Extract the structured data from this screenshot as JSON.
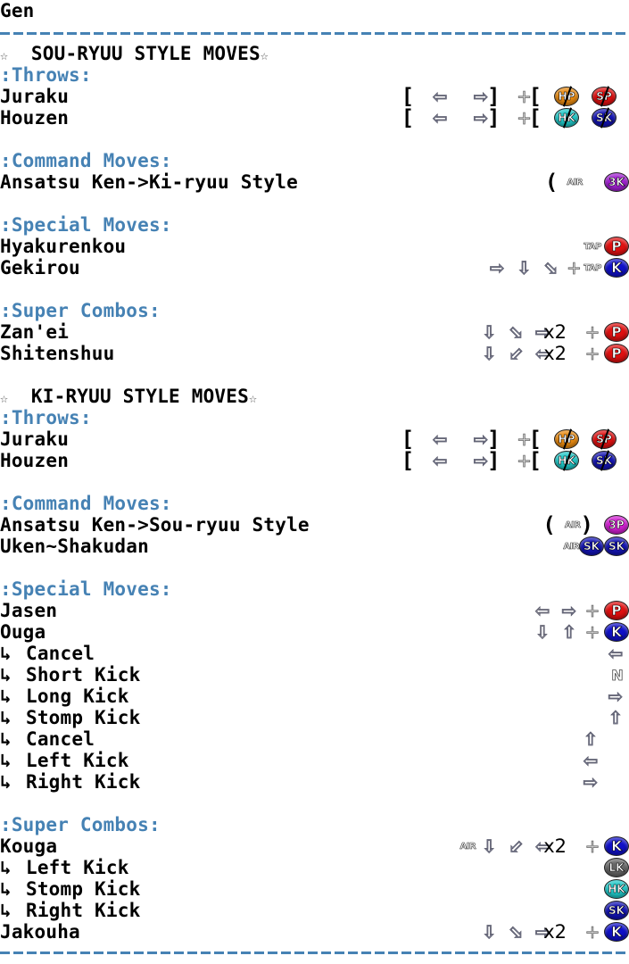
{
  "title": "Gen",
  "icons": {
    "star": "☆",
    "sub_arrow": "↳",
    "left": "⇦",
    "right": "⇨",
    "up": "⇧",
    "down": "⇩",
    "down_right": "⬂",
    "down_left": "⬃",
    "plus": "+",
    "open_bracket": "[",
    "close_bracket": "]",
    "open_paren": "(",
    "close_paren": ")"
  },
  "labels": {
    "tap": "TAP",
    "air": "AIR",
    "x2": "x2",
    "neutral": "N"
  },
  "sou_ryuu": {
    "heading": "SOU-RYUU STYLE MOVES",
    "throws_header": ":Throws:",
    "throws": [
      {
        "name": "Juraku",
        "buttons": [
          "HP",
          "SP"
        ]
      },
      {
        "name": "Houzen",
        "buttons": [
          "HK",
          "SK"
        ]
      }
    ],
    "command_header": ":Command Moves:",
    "command": [
      {
        "name": "Ansatsu Ken->Ki-ryuu Style",
        "button": "3K"
      }
    ],
    "special_header": ":Special Moves:",
    "special": [
      {
        "name": "Hyakurenkou",
        "button": "P"
      },
      {
        "name": "Gekirou",
        "button": "K"
      }
    ],
    "super_header": ":Super Combos:",
    "super": [
      {
        "name": "Zan'ei",
        "button": "P"
      },
      {
        "name": "Shitenshuu",
        "button": "P"
      }
    ]
  },
  "ki_ryuu": {
    "heading": "KI-RYUU STYLE MOVES",
    "throws_header": ":Throws:",
    "throws": [
      {
        "name": "Juraku",
        "buttons": [
          "HP",
          "SP"
        ]
      },
      {
        "name": "Houzen",
        "buttons": [
          "HK",
          "SK"
        ]
      }
    ],
    "command_header": ":Command Moves:",
    "command": [
      {
        "name": "Ansatsu Ken->Sou-ryuu Style",
        "button": "3P"
      },
      {
        "name": "Uken~Shakudan",
        "buttons": [
          "SK",
          "SK"
        ]
      }
    ],
    "special_header": ":Special Moves:",
    "special": [
      {
        "name": "Jasen",
        "button": "P"
      },
      {
        "name": "Ouga",
        "button": "K"
      },
      {
        "name": "Cancel"
      },
      {
        "name": "Short Kick"
      },
      {
        "name": "Long Kick"
      },
      {
        "name": "Stomp Kick"
      },
      {
        "name": "Cancel"
      },
      {
        "name": "Left Kick"
      },
      {
        "name": "Right Kick"
      }
    ],
    "super_header": ":Super Combos:",
    "super": [
      {
        "name": "Kouga",
        "button": "K"
      },
      {
        "name": "Left Kick",
        "button": "LK"
      },
      {
        "name": "Stomp Kick",
        "button": "HK"
      },
      {
        "name": "Right Kick",
        "button": "SK"
      },
      {
        "name": "Jakouha",
        "button": "K"
      }
    ]
  }
}
